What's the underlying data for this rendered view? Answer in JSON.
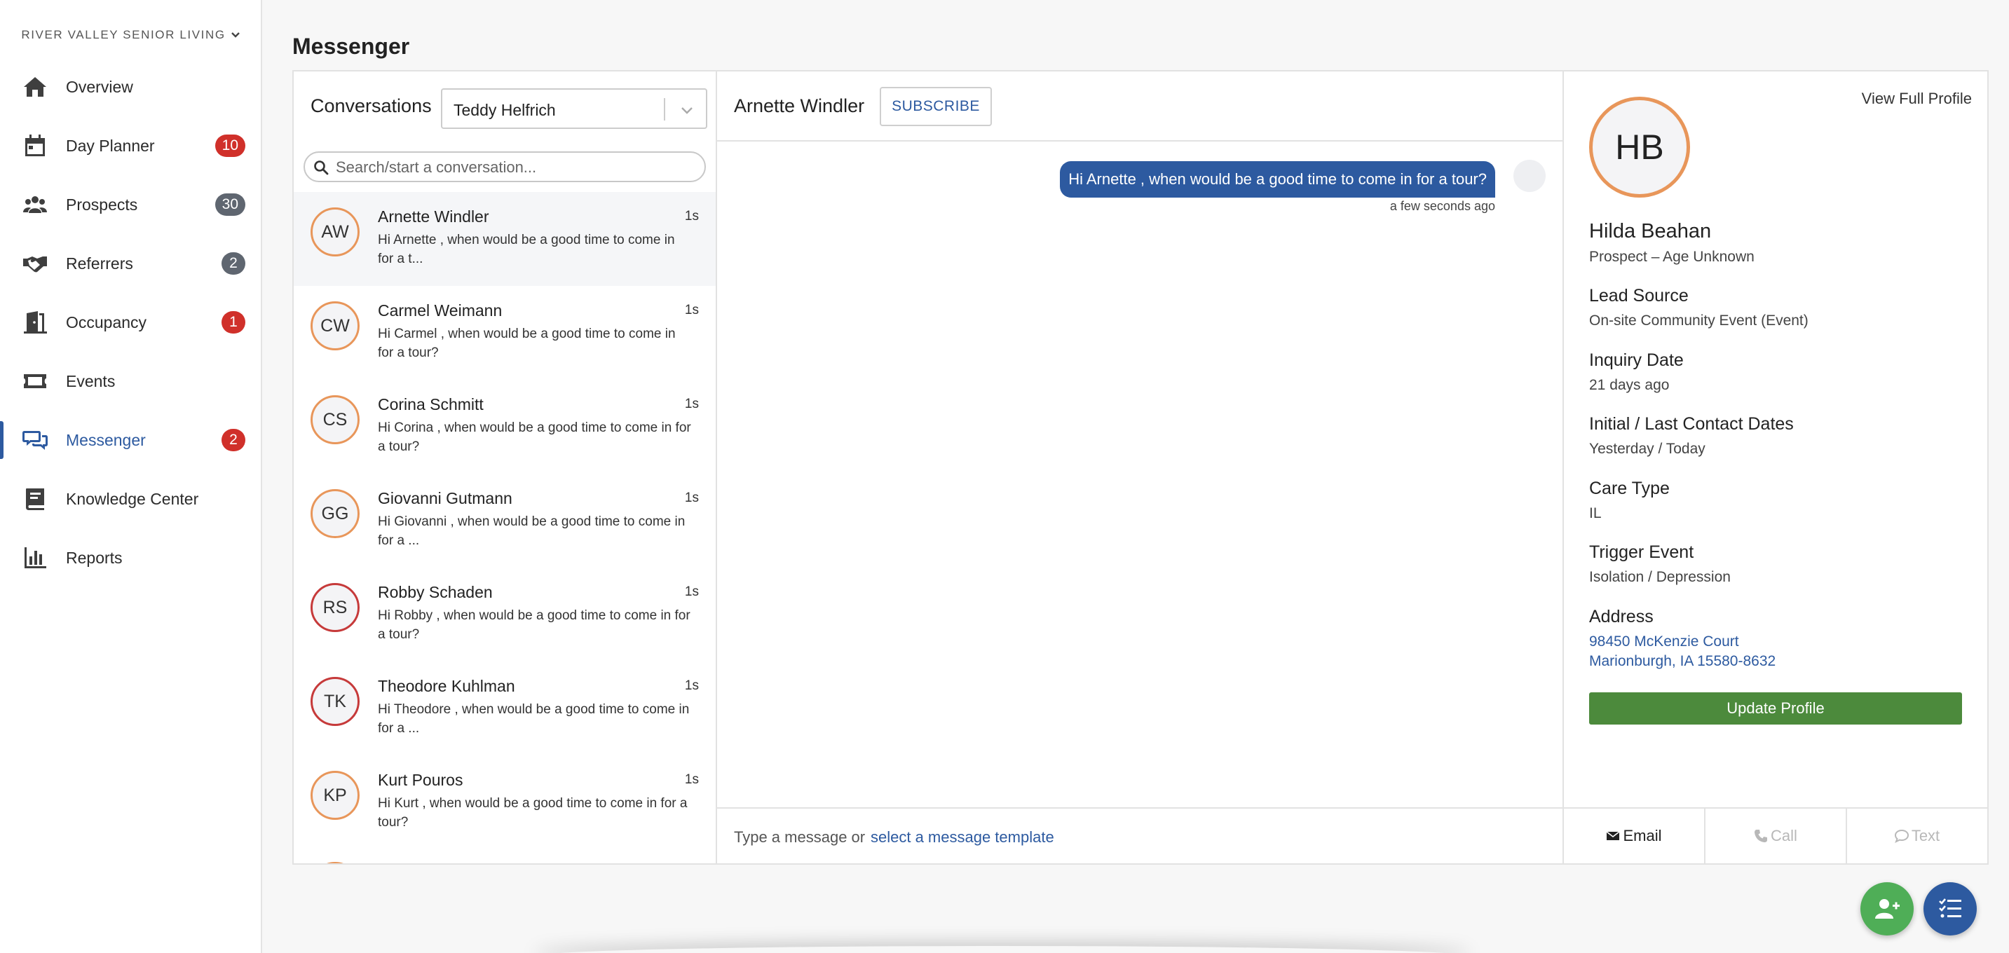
{
  "sidebar": {
    "community": "RIVER VALLEY SENIOR LIVING",
    "items": [
      {
        "label": "Overview",
        "icon": "home-icon"
      },
      {
        "label": "Day Planner",
        "icon": "calendar-icon",
        "badge": "10",
        "badge_color": "#d0302a"
      },
      {
        "label": "Prospects",
        "icon": "users-icon",
        "badge": "30",
        "badge_color": "#5f6670"
      },
      {
        "label": "Referrers",
        "icon": "handshake-icon",
        "badge": "2",
        "badge_color": "#5f6670"
      },
      {
        "label": "Occupancy",
        "icon": "door-icon",
        "badge": "1",
        "badge_color": "#d0302a"
      },
      {
        "label": "Events",
        "icon": "ticket-icon"
      },
      {
        "label": "Messenger",
        "icon": "chat-icon",
        "badge": "2",
        "badge_color": "#d0302a",
        "active": true
      },
      {
        "label": "Knowledge Center",
        "icon": "book-icon"
      },
      {
        "label": "Reports",
        "icon": "bar-chart-icon"
      }
    ]
  },
  "page": {
    "title": "Messenger"
  },
  "conversations": {
    "title": "Conversations",
    "owner": "Teddy Helfrich",
    "search_placeholder": "Search/start a conversation...",
    "items": [
      {
        "initials": "AW",
        "name": "Arnette Windler",
        "time": "1s",
        "preview": "Hi Arnette , when would be a good time to come in for a t..."
      },
      {
        "initials": "CW",
        "name": "Carmel Weimann",
        "time": "1s",
        "preview": "Hi Carmel , when would be a good time to come in for a tour?"
      },
      {
        "initials": "CS",
        "name": "Corina Schmitt",
        "time": "1s",
        "preview": "Hi Corina , when would be a good time to come in for a tour?"
      },
      {
        "initials": "GG",
        "name": "Giovanni Gutmann",
        "time": "1s",
        "preview": "Hi Giovanni , when would be a good time to come in for a ..."
      },
      {
        "initials": "RS",
        "name": "Robby Schaden",
        "time": "1s",
        "preview": "Hi Robby , when would be a good time to come in for a tour?"
      },
      {
        "initials": "TK",
        "name": "Theodore Kuhlman",
        "time": "1s",
        "preview": "Hi Theodore , when would be a good time to come in for a ..."
      },
      {
        "initials": "KP",
        "name": "Kurt Pouros",
        "time": "1s",
        "preview": "Hi Kurt , when would be a good time to come in for a tour?"
      }
    ]
  },
  "chat": {
    "contact_name": "Arnette Windler",
    "subscribe_label": "SUBSCRIBE",
    "message": {
      "text": "Hi Arnette , when would be a good time to come in for a tour?",
      "time": "a few seconds ago"
    },
    "composer_text": "Type a message or",
    "template_link": "select a message template"
  },
  "profile": {
    "view_full": "View Full Profile",
    "initials": "HB",
    "name": "Hilda Beahan",
    "subtitle": "Prospect – Age Unknown",
    "fields": [
      {
        "label": "Lead Source",
        "value": "On-site Community Event (Event)"
      },
      {
        "label": "Inquiry Date",
        "value": "21 days ago"
      },
      {
        "label": "Initial / Last Contact Dates",
        "value": "Yesterday / Today"
      },
      {
        "label": "Care Type",
        "value": "IL"
      },
      {
        "label": "Trigger Event",
        "value": "Isolation / Depression"
      }
    ],
    "address_label": "Address",
    "address_line1": "98450 McKenzie Court",
    "address_line2": "Marionburgh, IA 15580-8632",
    "update_button": "Update Profile",
    "actions": {
      "email": "Email",
      "call": "Call",
      "text": "Text"
    }
  },
  "colors": {
    "accent": "#2d5aa0",
    "success": "#4c8a3c",
    "badge_red": "#d0302a",
    "badge_gray": "#5f6670",
    "avatar_ring": "#e8965a"
  }
}
